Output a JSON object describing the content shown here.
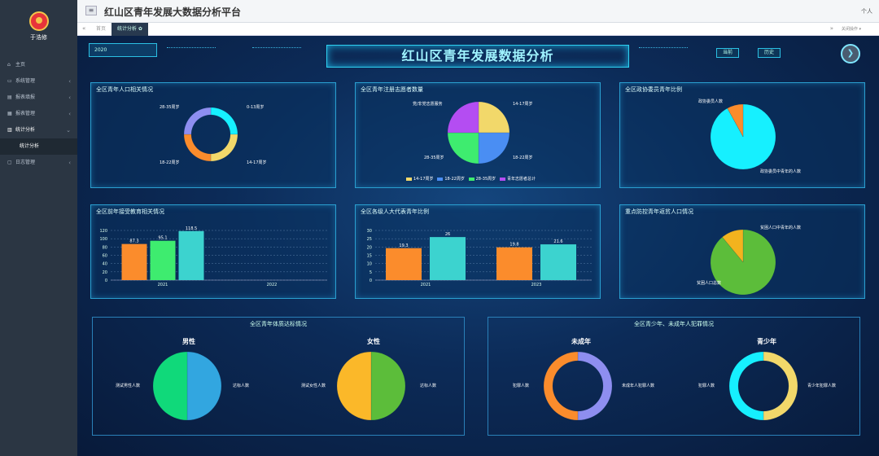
{
  "sidebar": {
    "user_name": "于浩修",
    "items": [
      {
        "icon": "home-icon",
        "glyph": "⌂",
        "label": "主页"
      },
      {
        "icon": "monitor-icon",
        "glyph": "▭",
        "label": "系统管理",
        "arrow": "‹"
      },
      {
        "icon": "folder-icon",
        "glyph": "▤",
        "label": "报表填报",
        "arrow": "‹"
      },
      {
        "icon": "grid-icon",
        "glyph": "▦",
        "label": "报表管理",
        "arrow": "‹"
      },
      {
        "icon": "chart-icon",
        "glyph": "▥",
        "label": "统计分析",
        "arrow": "⌄"
      },
      {
        "label": "统计分析"
      },
      {
        "icon": "log-icon",
        "glyph": "▢",
        "label": "日志管理",
        "arrow": "‹"
      }
    ]
  },
  "topbar": {
    "title": "红山区青年发展大数据分析平台",
    "user": "个人"
  },
  "tabs": {
    "prev": "«",
    "home": "首页",
    "active": "统计分析 ✿",
    "next": "»",
    "close_ops": "关闭操作 ▾"
  },
  "dashboard": {
    "year": "2020",
    "title": "红山区青年发展数据分析",
    "btn_current": "当前",
    "btn_history": "历史",
    "round_btn": "❯"
  },
  "panels": {
    "p1": {
      "title": "全区青年人口相关情况",
      "labels": [
        "28-35周岁",
        "0-13周岁",
        "18-22周岁",
        "14-17周岁"
      ]
    },
    "p2": {
      "title": "全区青年注册志愿者数量",
      "labels": [
        "党/非党志愿服务",
        "14-17周岁",
        "18-22周岁",
        "28-35周岁"
      ],
      "legend": [
        "14-17周岁",
        "18-22周岁",
        "28-35周岁",
        "青年志愿者总计"
      ]
    },
    "p3": {
      "title": "全区政协委员青年比例",
      "labels": [
        "政协委员人数",
        "政协委员中青年的人数"
      ]
    },
    "p4": {
      "title": "全区前年接受教育相关情况"
    },
    "p5": {
      "title": "全区各级人大代表青年比例"
    },
    "p6": {
      "title": "重点防控青年返贫人口情况",
      "labels": [
        "贫困人口中青年的人数",
        "贫困人口总数"
      ]
    }
  },
  "sections": {
    "s1": {
      "title": "全区青年体质达标情况",
      "male": "男性",
      "female": "女性",
      "male_labels": [
        "测试男性人数",
        "达标人数"
      ],
      "female_labels": [
        "测试女性人数",
        "达标人数"
      ]
    },
    "s2": {
      "title": "全区青少年、未成年人犯罪情况",
      "minor": "未成年",
      "youth": "青少年",
      "minor_labels": [
        "犯罪人数",
        "未成年人犯罪人数"
      ],
      "youth_labels": [
        "犯罪人数",
        "青少年犯罪人数"
      ]
    }
  },
  "colors": {
    "orange": "#fb8c2c",
    "green": "#3eec6f",
    "teal": "#3cd3cf",
    "yellow": "#f2d86a",
    "blue": "#4a8ef3",
    "purple": "#b44df2",
    "lime": "#5cbd3a",
    "cyan": "#16f0ff"
  },
  "chart_data": [
    {
      "type": "pie",
      "title": "全区青年人口相关情况",
      "donut": true,
      "slices": [
        {
          "label": "0-13周岁",
          "value": 25
        },
        {
          "label": "14-17周岁",
          "value": 25
        },
        {
          "label": "18-22周岁",
          "value": 25
        },
        {
          "label": "28-35周岁",
          "value": 25
        }
      ]
    },
    {
      "type": "pie",
      "title": "全区青年注册志愿者数量",
      "slices": [
        {
          "label": "14-17周岁",
          "value": 25
        },
        {
          "label": "18-22周岁",
          "value": 25
        },
        {
          "label": "28-35周岁",
          "value": 25
        },
        {
          "label": "青年志愿者总计",
          "value": 25
        }
      ]
    },
    {
      "type": "pie",
      "title": "全区政协委员青年比例",
      "slices": [
        {
          "label": "政协委员中青年的人数",
          "value": 92
        },
        {
          "label": "政协委员人数",
          "value": 8
        }
      ]
    },
    {
      "type": "bar",
      "title": "全区前年接受教育相关情况",
      "categories": [
        "2021",
        "2022"
      ],
      "series": [
        {
          "values": [
            87.3,
            null
          ]
        },
        {
          "values": [
            95.1,
            null
          ]
        },
        {
          "values": [
            118.5,
            null
          ]
        }
      ],
      "ylim": [
        0,
        120
      ],
      "yticks": [
        0,
        20,
        40,
        60,
        80,
        100,
        120
      ]
    },
    {
      "type": "bar",
      "title": "全区各级人大代表青年比例",
      "categories": [
        "2021",
        "2023"
      ],
      "series": [
        {
          "values": [
            19.3,
            19.8
          ]
        },
        {
          "values": [
            26,
            21.6
          ]
        }
      ],
      "ylim": [
        0,
        30
      ],
      "yticks": [
        0,
        5,
        10,
        15,
        20,
        25,
        30
      ]
    },
    {
      "type": "pie",
      "title": "重点防控青年返贫人口情况",
      "slices": [
        {
          "label": "贫困人口总数",
          "value": 89
        },
        {
          "label": "贫困人口中青年的人数",
          "value": 11
        }
      ]
    },
    {
      "type": "pie",
      "title": "男性",
      "slices": [
        {
          "label": "达标人数",
          "value": 50
        },
        {
          "label": "测试男性人数",
          "value": 50
        }
      ]
    },
    {
      "type": "pie",
      "title": "女性",
      "slices": [
        {
          "label": "达标人数",
          "value": 50
        },
        {
          "label": "测试女性人数",
          "value": 50
        }
      ]
    },
    {
      "type": "pie",
      "title": "未成年",
      "donut": true,
      "slices": [
        {
          "label": "未成年人犯罪人数",
          "value": 50
        },
        {
          "label": "犯罪人数",
          "value": 50
        }
      ]
    },
    {
      "type": "pie",
      "title": "青少年",
      "donut": true,
      "slices": [
        {
          "label": "青少年犯罪人数",
          "value": 50
        },
        {
          "label": "犯罪人数",
          "value": 50
        }
      ]
    }
  ]
}
